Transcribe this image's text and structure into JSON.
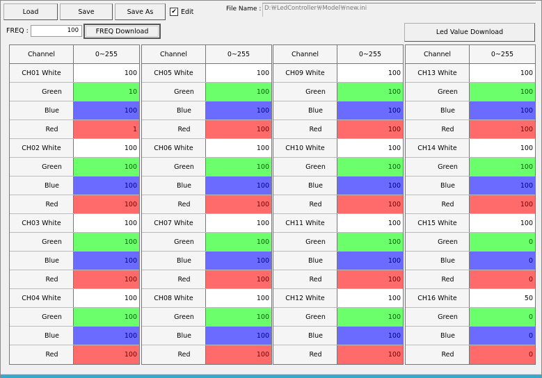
{
  "toolbar": {
    "load": "Load",
    "save": "Save",
    "save_as": "Save As",
    "edit_label": "Edit",
    "edit_checked": true,
    "file_name_label": "File Name :",
    "file_name": "D:￦LedController￦Model￦new.ini",
    "freq_label": "FREQ :",
    "freq_value": "100",
    "freq_download": "FREQ Download",
    "led_download": "Led Value Download"
  },
  "colors": {
    "white": "#ffffff",
    "green": "#6cff6c",
    "blue": "#6b6bff",
    "red": "#ff6b6b",
    "green_text": "#006000",
    "blue_text": "#000080",
    "red_text": "#700000"
  },
  "table_header": {
    "channel": "Channel",
    "range": "0~255"
  },
  "color_labels": {
    "white": "White",
    "green": "Green",
    "blue": "Blue",
    "red": "Red"
  },
  "tables": [
    {
      "channels": [
        {
          "name": "CH01",
          "white": "100",
          "green": "10",
          "blue": "100",
          "red": "1"
        },
        {
          "name": "CH02",
          "white": "100",
          "green": "100",
          "blue": "100",
          "red": "100"
        },
        {
          "name": "CH03",
          "white": "100",
          "green": "100",
          "blue": "100",
          "red": "100"
        },
        {
          "name": "CH04",
          "white": "100",
          "green": "100",
          "blue": "100",
          "red": "100"
        }
      ]
    },
    {
      "channels": [
        {
          "name": "CH05",
          "white": "100",
          "green": "100",
          "blue": "100",
          "red": "100"
        },
        {
          "name": "CH06",
          "white": "100",
          "green": "100",
          "blue": "100",
          "red": "100"
        },
        {
          "name": "CH07",
          "white": "100",
          "green": "100",
          "blue": "100",
          "red": "100"
        },
        {
          "name": "CH08",
          "white": "100",
          "green": "100",
          "blue": "100",
          "red": "100"
        }
      ]
    },
    {
      "channels": [
        {
          "name": "CH09",
          "white": "100",
          "green": "100",
          "blue": "100",
          "red": "100"
        },
        {
          "name": "CH10",
          "white": "100",
          "green": "100",
          "blue": "100",
          "red": "100"
        },
        {
          "name": "CH11",
          "white": "100",
          "green": "100",
          "blue": "100",
          "red": "100"
        },
        {
          "name": "CH12",
          "white": "100",
          "green": "100",
          "blue": "100",
          "red": "100"
        }
      ]
    },
    {
      "channels": [
        {
          "name": "CH13",
          "white": "100",
          "green": "100",
          "blue": "100",
          "red": "100"
        },
        {
          "name": "CH14",
          "white": "100",
          "green": "100",
          "blue": "100",
          "red": "100"
        },
        {
          "name": "CH15",
          "white": "100",
          "green": "0",
          "blue": "0",
          "red": "0"
        },
        {
          "name": "CH16",
          "white": "50",
          "green": "0",
          "blue": "0",
          "red": "0"
        }
      ]
    }
  ]
}
